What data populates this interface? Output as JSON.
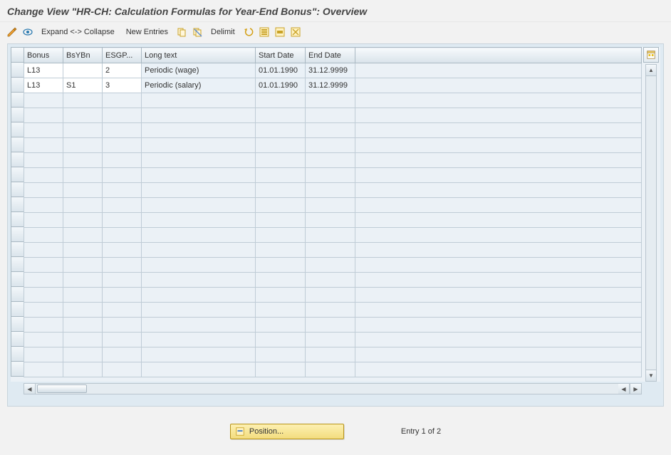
{
  "title": "Change View \"HR-CH: Calculation Formulas for Year-End Bonus\": Overview",
  "toolbar": {
    "expand_collapse": "Expand <-> Collapse",
    "new_entries": "New Entries",
    "delimit": "Delimit"
  },
  "columns": {
    "bonus": "Bonus",
    "bsybn": "BsYBn",
    "esgp": "ESGP...",
    "long_text": "Long text",
    "start_date": "Start Date",
    "end_date": "End Date"
  },
  "rows": [
    {
      "bonus": "L13",
      "bsybn": "",
      "esgp": "2",
      "long_text": "Periodic (wage)",
      "start_date": "01.01.1990",
      "end_date": "31.12.9999"
    },
    {
      "bonus": "L13",
      "bsybn": "S1",
      "esgp": "3",
      "long_text": "Periodic (salary)",
      "start_date": "01.01.1990",
      "end_date": "31.12.9999"
    }
  ],
  "empty_row_count": 19,
  "position_button": "Position...",
  "entry_status": "Entry 1 of 2"
}
